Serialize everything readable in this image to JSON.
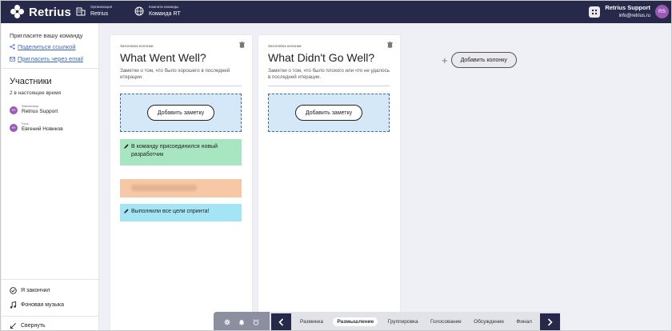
{
  "app": {
    "name": "Retrius"
  },
  "header": {
    "org_label": "Организация",
    "org_value": "Retrius",
    "team_label": "Комната команды",
    "team_value": "Команда RT",
    "user_name": "Retrius Support",
    "user_email": "info@retrius.ru",
    "user_initials": "RS"
  },
  "sidebar": {
    "invite_title": "Пригласите вашу команду",
    "share_link": "Поделиться ссылкой",
    "invite_email": "Пригласить через email",
    "participants_title": "Участники",
    "online_count": "2 в настоящее время",
    "members": [
      {
        "role": "Фасилитатор",
        "name": "Retrius Support",
        "initials": "RS",
        "color": "#9b59b6"
      },
      {
        "role": "Гость",
        "name": "Евгений Новиков",
        "initials": "EH",
        "color": "#9b59b6"
      }
    ],
    "done_label": "Я закончил",
    "music_label": "Фоновая музыка",
    "collapse_label": "Свернуть"
  },
  "columns": [
    {
      "kicker": "Заголовок колонки",
      "title": "What Went Well?",
      "description": "Заметки о том, что было хорошего в последней итерации.",
      "add_note": "Добавить заметку",
      "notes": [
        {
          "text": "В команду присоединился новый разработчик",
          "color": "#a8e6c2",
          "blurred": false
        },
        {
          "text": "",
          "color": "#f7c8a6",
          "blurred": true
        },
        {
          "text": "Выполнили все цели спринта!",
          "color": "#a3e5f5",
          "blurred": false
        }
      ]
    },
    {
      "kicker": "Заголовок колонки",
      "title": "What Didn't Go Well?",
      "description": "Заметки о том, что было плохого или что не удалось в последней итерации.",
      "add_note": "Добавить заметку",
      "notes": []
    }
  ],
  "add_column": "Добавить колонку",
  "phases": [
    "Разминка",
    "Размышление",
    "Группировка",
    "Голосование",
    "Обсуждение",
    "Финал"
  ],
  "active_phase": "Размышление",
  "colors": {
    "header_bg": "#26294a",
    "accent_link": "#3a68c7",
    "dropzone": "#d4e8f8"
  },
  "icons": [
    "organization-icon",
    "globe-icon",
    "apps-icon",
    "share-icon",
    "mail-icon",
    "trash-icon",
    "pencil-icon",
    "emoji-icon",
    "image-icon",
    "check-circle-icon",
    "music-icon",
    "collapse-icon",
    "settings-icon",
    "bell-icon",
    "timer-icon",
    "chevron-left-icon",
    "chevron-right-icon"
  ]
}
